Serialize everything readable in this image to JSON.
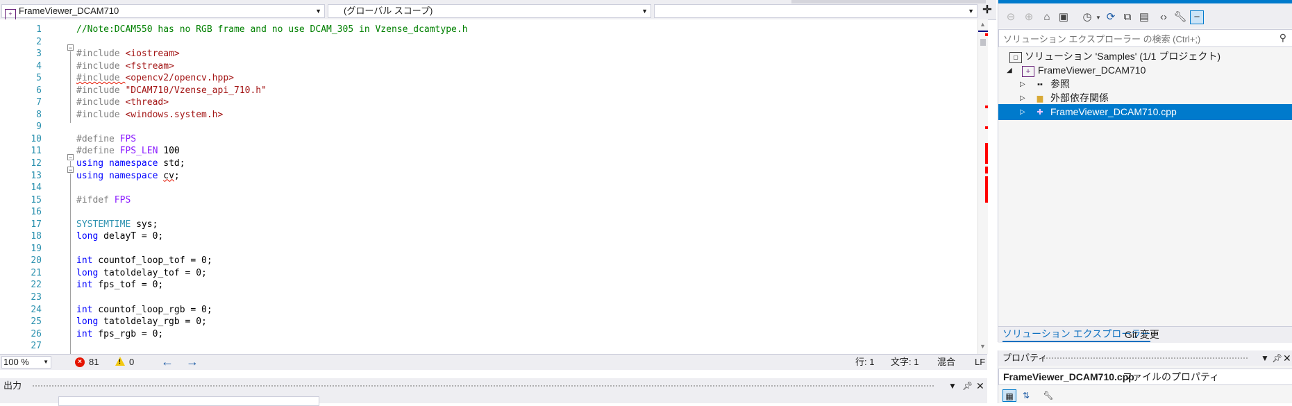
{
  "navbar": {
    "file_combo": "FrameViewer_DCAM710",
    "scope_combo": "(グローバル スコープ)",
    "member_combo": ""
  },
  "editor": {
    "lines": [
      {
        "n": "1",
        "tokens": [
          {
            "t": "comment",
            "v": "//Note:DCAM550 has no RGB frame and no use DCAM_305 in Vzense_dcamtype.h"
          }
        ]
      },
      {
        "n": "2",
        "tokens": []
      },
      {
        "n": "3",
        "tokens": [
          {
            "t": "pp",
            "v": "#include "
          },
          {
            "t": "str",
            "v": "<iostream>"
          }
        ]
      },
      {
        "n": "4",
        "tokens": [
          {
            "t": "pp",
            "v": "#include "
          },
          {
            "t": "str",
            "v": "<fstream>"
          }
        ]
      },
      {
        "n": "5",
        "tokens": [
          {
            "t": "pp",
            "v": "#include ",
            "sq": true
          },
          {
            "t": "str",
            "v": "<opencv2/opencv.hpp>"
          }
        ]
      },
      {
        "n": "6",
        "tokens": [
          {
            "t": "pp",
            "v": "#include "
          },
          {
            "t": "str",
            "v": "\"DCAM710/Vzense_api_710.h\""
          }
        ]
      },
      {
        "n": "7",
        "tokens": [
          {
            "t": "pp",
            "v": "#include "
          },
          {
            "t": "str",
            "v": "<thread>"
          }
        ]
      },
      {
        "n": "8",
        "tokens": [
          {
            "t": "pp",
            "v": "#include "
          },
          {
            "t": "str",
            "v": "<windows.system.h>"
          }
        ]
      },
      {
        "n": "9",
        "tokens": []
      },
      {
        "n": "10",
        "tokens": [
          {
            "t": "pp",
            "v": "#define "
          },
          {
            "t": "macro",
            "v": "FPS"
          }
        ]
      },
      {
        "n": "11",
        "tokens": [
          {
            "t": "pp",
            "v": "#define "
          },
          {
            "t": "macro",
            "v": "FPS_LEN"
          },
          {
            "t": "plain",
            "v": " 100"
          }
        ]
      },
      {
        "n": "12",
        "tokens": [
          {
            "t": "kw",
            "v": "using"
          },
          {
            "t": "plain",
            "v": " "
          },
          {
            "t": "kw",
            "v": "namespace"
          },
          {
            "t": "plain",
            "v": " std;"
          }
        ]
      },
      {
        "n": "13",
        "tokens": [
          {
            "t": "kw",
            "v": "using"
          },
          {
            "t": "plain",
            "v": " "
          },
          {
            "t": "kw",
            "v": "namespace"
          },
          {
            "t": "plain",
            "v": " "
          },
          {
            "t": "plain",
            "v": "cv",
            "sq": true
          },
          {
            "t": "plain",
            "v": ";"
          }
        ]
      },
      {
        "n": "14",
        "tokens": []
      },
      {
        "n": "15",
        "tokens": [
          {
            "t": "pp",
            "v": "#ifdef "
          },
          {
            "t": "macro",
            "v": "FPS"
          }
        ]
      },
      {
        "n": "16",
        "tokens": []
      },
      {
        "n": "17",
        "tokens": [
          {
            "t": "type",
            "v": "SYSTEMTIME"
          },
          {
            "t": "plain",
            "v": " sys;"
          }
        ]
      },
      {
        "n": "18",
        "tokens": [
          {
            "t": "kw",
            "v": "long"
          },
          {
            "t": "plain",
            "v": " delayT = 0;"
          }
        ]
      },
      {
        "n": "19",
        "tokens": []
      },
      {
        "n": "20",
        "tokens": [
          {
            "t": "kw",
            "v": "int"
          },
          {
            "t": "plain",
            "v": " countof_loop_tof = 0;"
          }
        ]
      },
      {
        "n": "21",
        "tokens": [
          {
            "t": "kw",
            "v": "long"
          },
          {
            "t": "plain",
            "v": " tatoldelay_tof = 0;"
          }
        ]
      },
      {
        "n": "22",
        "tokens": [
          {
            "t": "kw",
            "v": "int"
          },
          {
            "t": "plain",
            "v": " fps_tof = 0;"
          }
        ]
      },
      {
        "n": "23",
        "tokens": []
      },
      {
        "n": "24",
        "tokens": [
          {
            "t": "kw",
            "v": "int"
          },
          {
            "t": "plain",
            "v": " countof_loop_rgb = 0;"
          }
        ]
      },
      {
        "n": "25",
        "tokens": [
          {
            "t": "kw",
            "v": "long"
          },
          {
            "t": "plain",
            "v": " tatoldelay_rgb = 0;"
          }
        ]
      },
      {
        "n": "26",
        "tokens": [
          {
            "t": "kw",
            "v": "int"
          },
          {
            "t": "plain",
            "v": " fps_rgb = 0;"
          }
        ]
      },
      {
        "n": "27",
        "tokens": []
      }
    ]
  },
  "status": {
    "zoom": "100 %",
    "errors": "81",
    "warnings": "0",
    "line": "行: 1",
    "char": "文字: 1",
    "mode": "混合",
    "eol": "LF"
  },
  "output": {
    "title": "出力"
  },
  "solution_explorer": {
    "search_placeholder": "ソリューション エクスプローラー の検索 (Ctrl+;)",
    "tree": [
      {
        "label": "ソリューション 'Samples' (1/1 プロジェクト)",
        "icon": "solution-icon",
        "level": 0
      },
      {
        "label": "FrameViewer_DCAM710",
        "icon": "cpp-project-icon",
        "level": 1,
        "expanded": true
      },
      {
        "label": "参照",
        "icon": "references-icon",
        "level": 2
      },
      {
        "label": "外部依存関係",
        "icon": "external-dependencies-icon",
        "level": 2
      },
      {
        "label": "FrameViewer_DCAM710.cpp",
        "icon": "cpp-file-icon",
        "level": 2,
        "selected": true
      }
    ],
    "tabs": {
      "solex": "ソリューション エクスプローラー",
      "git": "Git 変更"
    }
  },
  "properties": {
    "title": "プロパティ",
    "object_name": "FrameViewer_DCAM710.cpp",
    "object_type": "ファイルのプロパティ"
  },
  "colors": {
    "accent": "#007acc",
    "error_marker": "#ff0000",
    "comment": "#008000",
    "keyword": "#0000ff",
    "string": "#a31515",
    "macro": "#8a1bff"
  }
}
